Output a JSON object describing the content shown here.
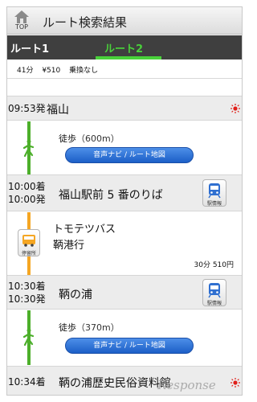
{
  "header": {
    "title": "ルート検索結果",
    "top_label": "TOP"
  },
  "tabs": [
    {
      "label": "ルート1"
    },
    {
      "label": "ルート2"
    }
  ],
  "summary": {
    "duration": "41分",
    "fare": "¥510",
    "transfer": "乗換なし"
  },
  "route": {
    "departure": {
      "time": "09:53発",
      "name": "福山"
    },
    "walk1": {
      "label": "徒歩",
      "distance": "（600m）",
      "nav_button": "音声ナビ / ルート地図"
    },
    "stop1": {
      "arrive": "10:00着",
      "depart": "10:00発",
      "name": "福山駅前 5 番のりば",
      "info_label": "駅情報"
    },
    "bus": {
      "line": "トモテツバス",
      "dest": "鞆港行",
      "stop_label": "停留所",
      "time_fare": "30分 510円"
    },
    "stop2": {
      "arrive": "10:30着",
      "depart": "10:30発",
      "name": "鞆の浦",
      "info_label": "駅情報"
    },
    "walk2": {
      "label": "徒歩",
      "distance": "（370m）",
      "nav_button": "音声ナビ / ルート地図"
    },
    "arrival": {
      "time": "10:34着",
      "name": "鞆の浦歴史民俗資料館"
    }
  },
  "watermark": "Response",
  "colors": {
    "tab_active": "#49d23a",
    "walk_line": "#4caf2a",
    "bus_line": "#f5a623",
    "nav_button": "#2a6fd6",
    "sun": "#e0201b"
  }
}
